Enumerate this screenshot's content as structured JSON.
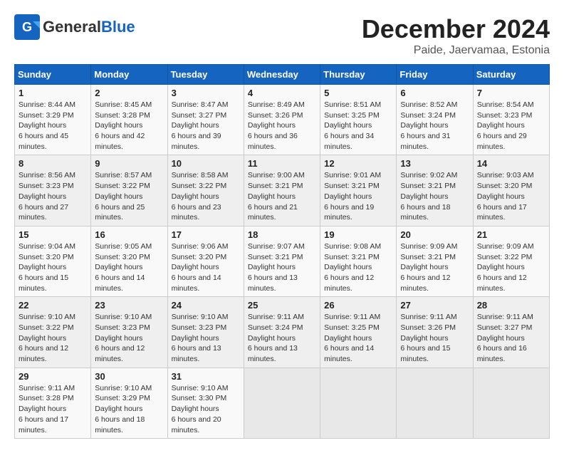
{
  "header": {
    "logo_general": "General",
    "logo_blue": "Blue",
    "month": "December 2024",
    "location": "Paide, Jaervamaa, Estonia"
  },
  "calendar": {
    "days_of_week": [
      "Sunday",
      "Monday",
      "Tuesday",
      "Wednesday",
      "Thursday",
      "Friday",
      "Saturday"
    ],
    "weeks": [
      [
        {
          "day": "1",
          "sunrise": "8:44 AM",
          "sunset": "3:29 PM",
          "daylight": "6 hours and 45 minutes."
        },
        {
          "day": "2",
          "sunrise": "8:45 AM",
          "sunset": "3:28 PM",
          "daylight": "6 hours and 42 minutes."
        },
        {
          "day": "3",
          "sunrise": "8:47 AM",
          "sunset": "3:27 PM",
          "daylight": "6 hours and 39 minutes."
        },
        {
          "day": "4",
          "sunrise": "8:49 AM",
          "sunset": "3:26 PM",
          "daylight": "6 hours and 36 minutes."
        },
        {
          "day": "5",
          "sunrise": "8:51 AM",
          "sunset": "3:25 PM",
          "daylight": "6 hours and 34 minutes."
        },
        {
          "day": "6",
          "sunrise": "8:52 AM",
          "sunset": "3:24 PM",
          "daylight": "6 hours and 31 minutes."
        },
        {
          "day": "7",
          "sunrise": "8:54 AM",
          "sunset": "3:23 PM",
          "daylight": "6 hours and 29 minutes."
        }
      ],
      [
        {
          "day": "8",
          "sunrise": "8:56 AM",
          "sunset": "3:23 PM",
          "daylight": "6 hours and 27 minutes."
        },
        {
          "day": "9",
          "sunrise": "8:57 AM",
          "sunset": "3:22 PM",
          "daylight": "6 hours and 25 minutes."
        },
        {
          "day": "10",
          "sunrise": "8:58 AM",
          "sunset": "3:22 PM",
          "daylight": "6 hours and 23 minutes."
        },
        {
          "day": "11",
          "sunrise": "9:00 AM",
          "sunset": "3:21 PM",
          "daylight": "6 hours and 21 minutes."
        },
        {
          "day": "12",
          "sunrise": "9:01 AM",
          "sunset": "3:21 PM",
          "daylight": "6 hours and 19 minutes."
        },
        {
          "day": "13",
          "sunrise": "9:02 AM",
          "sunset": "3:21 PM",
          "daylight": "6 hours and 18 minutes."
        },
        {
          "day": "14",
          "sunrise": "9:03 AM",
          "sunset": "3:20 PM",
          "daylight": "6 hours and 17 minutes."
        }
      ],
      [
        {
          "day": "15",
          "sunrise": "9:04 AM",
          "sunset": "3:20 PM",
          "daylight": "6 hours and 15 minutes."
        },
        {
          "day": "16",
          "sunrise": "9:05 AM",
          "sunset": "3:20 PM",
          "daylight": "6 hours and 14 minutes."
        },
        {
          "day": "17",
          "sunrise": "9:06 AM",
          "sunset": "3:20 PM",
          "daylight": "6 hours and 14 minutes."
        },
        {
          "day": "18",
          "sunrise": "9:07 AM",
          "sunset": "3:21 PM",
          "daylight": "6 hours and 13 minutes."
        },
        {
          "day": "19",
          "sunrise": "9:08 AM",
          "sunset": "3:21 PM",
          "daylight": "6 hours and 12 minutes."
        },
        {
          "day": "20",
          "sunrise": "9:09 AM",
          "sunset": "3:21 PM",
          "daylight": "6 hours and 12 minutes."
        },
        {
          "day": "21",
          "sunrise": "9:09 AM",
          "sunset": "3:22 PM",
          "daylight": "6 hours and 12 minutes."
        }
      ],
      [
        {
          "day": "22",
          "sunrise": "9:10 AM",
          "sunset": "3:22 PM",
          "daylight": "6 hours and 12 minutes."
        },
        {
          "day": "23",
          "sunrise": "9:10 AM",
          "sunset": "3:23 PM",
          "daylight": "6 hours and 12 minutes."
        },
        {
          "day": "24",
          "sunrise": "9:10 AM",
          "sunset": "3:23 PM",
          "daylight": "6 hours and 13 minutes."
        },
        {
          "day": "25",
          "sunrise": "9:11 AM",
          "sunset": "3:24 PM",
          "daylight": "6 hours and 13 minutes."
        },
        {
          "day": "26",
          "sunrise": "9:11 AM",
          "sunset": "3:25 PM",
          "daylight": "6 hours and 14 minutes."
        },
        {
          "day": "27",
          "sunrise": "9:11 AM",
          "sunset": "3:26 PM",
          "daylight": "6 hours and 15 minutes."
        },
        {
          "day": "28",
          "sunrise": "9:11 AM",
          "sunset": "3:27 PM",
          "daylight": "6 hours and 16 minutes."
        }
      ],
      [
        {
          "day": "29",
          "sunrise": "9:11 AM",
          "sunset": "3:28 PM",
          "daylight": "6 hours and 17 minutes."
        },
        {
          "day": "30",
          "sunrise": "9:10 AM",
          "sunset": "3:29 PM",
          "daylight": "6 hours and 18 minutes."
        },
        {
          "day": "31",
          "sunrise": "9:10 AM",
          "sunset": "3:30 PM",
          "daylight": "6 hours and 20 minutes."
        },
        null,
        null,
        null,
        null
      ]
    ]
  }
}
